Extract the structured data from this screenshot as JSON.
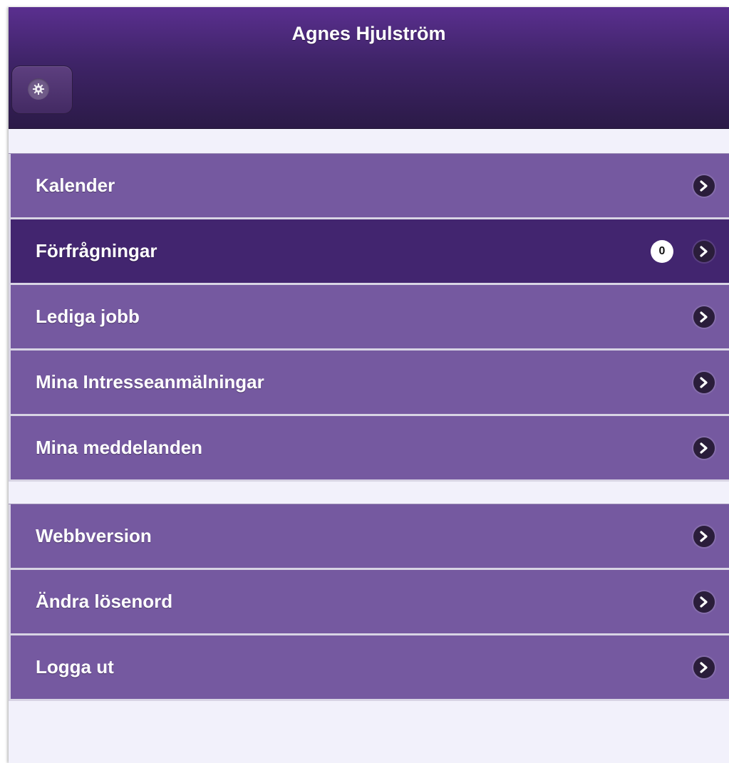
{
  "header": {
    "title": "Agnes Hjulström",
    "settings_icon": "gear-icon"
  },
  "menu_main": {
    "items": [
      {
        "label": "Kalender",
        "icon": "chevron-right-icon"
      },
      {
        "label": "Förfrågningar",
        "badge": "0",
        "icon": "chevron-right-icon",
        "active": true
      },
      {
        "label": "Lediga jobb",
        "icon": "chevron-right-icon"
      },
      {
        "label": "Mina Intresseanmälningar",
        "icon": "chevron-right-icon"
      },
      {
        "label": "Mina meddelanden",
        "icon": "chevron-right-icon"
      }
    ]
  },
  "menu_account": {
    "items": [
      {
        "label": "Webbversion",
        "icon": "chevron-right-icon"
      },
      {
        "label": "Ändra lösenord",
        "icon": "chevron-right-icon"
      },
      {
        "label": "Logga ut",
        "icon": "chevron-right-icon"
      }
    ]
  },
  "colors": {
    "header_top": "#5a2f8f",
    "header_bottom": "#2b1a47",
    "item": "#7559a0",
    "item_active": "#42256f",
    "background": "#f2f1fb"
  }
}
